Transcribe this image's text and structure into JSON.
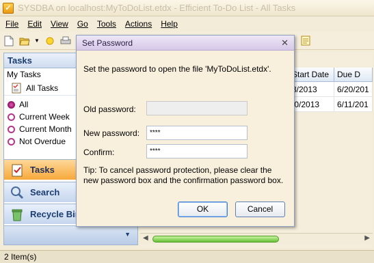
{
  "window": {
    "title": "SYSDBA on localhost:MyToDoList.etdx - Efficient To-Do List - All Tasks"
  },
  "menu": [
    {
      "label": "File",
      "name": "menu-file"
    },
    {
      "label": "Edit",
      "name": "menu-edit"
    },
    {
      "label": "View",
      "name": "menu-view"
    },
    {
      "label": "Go",
      "name": "menu-go"
    },
    {
      "label": "Tools",
      "name": "menu-tools"
    },
    {
      "label": "Actions",
      "name": "menu-actions"
    },
    {
      "label": "Help",
      "name": "menu-help"
    }
  ],
  "toolbar": {
    "icons": [
      "new-document-icon",
      "open-folder-icon",
      "dropdown-arrow-icon",
      "bulb-icon",
      "print-icon",
      "note-icon"
    ]
  },
  "left_pane": {
    "header": "Tasks",
    "list_caption": "My Tasks",
    "all_tasks_label": "All Tasks",
    "filters": [
      {
        "label": "All",
        "selected": true
      },
      {
        "label": "Current Week",
        "selected": false
      },
      {
        "label": "Current Month",
        "selected": false
      },
      {
        "label": "Not Overdue",
        "selected": false
      }
    ],
    "nav": {
      "tasks": "Tasks",
      "search": "Search",
      "recycle_bin": "Recycle Bin"
    }
  },
  "grid": {
    "columns": [
      "Start Date",
      "Due D"
    ],
    "rows": [
      [
        "3/2013",
        "6/20/201"
      ],
      [
        ".0/2013",
        "6/11/201"
      ]
    ]
  },
  "status": {
    "items_text": "2 Item(s)"
  },
  "dialog": {
    "title": "Set Password",
    "instruction": "Set the password to open the file 'MyToDoList.etdx'.",
    "old_password_label": "Old password:",
    "new_password_label": "New password:",
    "confirm_label": "Confirm:",
    "new_password_value": "****",
    "confirm_value": "****",
    "tip": "Tip: To cancel password protection, please clear the new password box and the confirmation password box.",
    "ok_label": "OK",
    "cancel_label": "Cancel"
  },
  "colors": {
    "accent_tasks": "#f7a83a",
    "scroll_thumb": "#68c23a",
    "pane_header_text": "#1b3d72"
  }
}
